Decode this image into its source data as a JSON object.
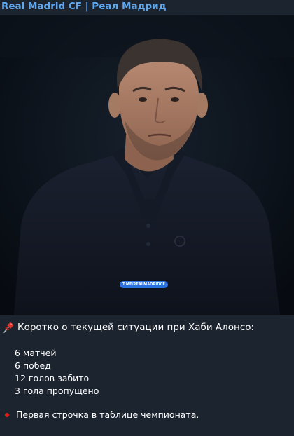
{
  "channel": {
    "title": "Real Madrid CF | Реал Мадрид"
  },
  "photo": {
    "watermark": "T.ME/REALMADRIDCF",
    "subject": "man-in-dark-polo"
  },
  "post": {
    "headline_icon": "pushpin-icon",
    "headline": "Коротко о текущей ситуации при Хаби Алонсо:",
    "stats": [
      "6 матчей",
      "6 побед",
      "12 голов забито",
      "3 гола пропущено"
    ],
    "note_icon": "red-circle-icon",
    "note": "Первая строчка в таблице чемпионата."
  },
  "colors": {
    "background": "#1c2430",
    "channel_title": "#5ea8f0",
    "watermark_badge": "#2b6fe0",
    "note_dot": "#e0231e"
  }
}
